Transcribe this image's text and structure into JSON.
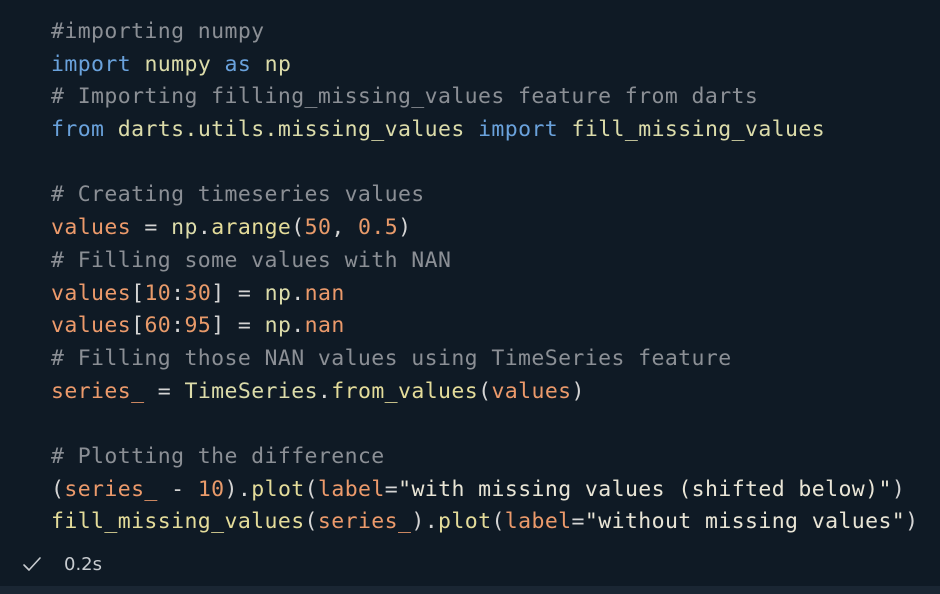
{
  "code_lines": [
    [
      {
        "t": "#importing numpy",
        "c": "comment"
      }
    ],
    [
      {
        "t": "import",
        "c": "keyword"
      },
      {
        "t": " ",
        "c": "plain"
      },
      {
        "t": "numpy",
        "c": "module"
      },
      {
        "t": " ",
        "c": "plain"
      },
      {
        "t": "as",
        "c": "keyword"
      },
      {
        "t": " ",
        "c": "plain"
      },
      {
        "t": "np",
        "c": "module"
      }
    ],
    [
      {
        "t": "# Importing filling_missing_values feature from darts",
        "c": "comment"
      }
    ],
    [
      {
        "t": "from",
        "c": "keyword"
      },
      {
        "t": " ",
        "c": "plain"
      },
      {
        "t": "darts.utils.missing_values",
        "c": "module"
      },
      {
        "t": " ",
        "c": "plain"
      },
      {
        "t": "import",
        "c": "keyword"
      },
      {
        "t": " ",
        "c": "plain"
      },
      {
        "t": "fill_missing_values",
        "c": "module"
      }
    ],
    [],
    [
      {
        "t": "# Creating timeseries values",
        "c": "comment"
      }
    ],
    [
      {
        "t": "values",
        "c": "var"
      },
      {
        "t": " = ",
        "c": "plain"
      },
      {
        "t": "np",
        "c": "module"
      },
      {
        "t": ".",
        "c": "plain"
      },
      {
        "t": "arange",
        "c": "func"
      },
      {
        "t": "(",
        "c": "paren"
      },
      {
        "t": "50",
        "c": "num"
      },
      {
        "t": ", ",
        "c": "plain"
      },
      {
        "t": "0.5",
        "c": "num"
      },
      {
        "t": ")",
        "c": "paren"
      }
    ],
    [
      {
        "t": "# Filling some values with NAN",
        "c": "comment"
      }
    ],
    [
      {
        "t": "values",
        "c": "var"
      },
      {
        "t": "[",
        "c": "plain"
      },
      {
        "t": "10",
        "c": "num"
      },
      {
        "t": ":",
        "c": "plain"
      },
      {
        "t": "30",
        "c": "num"
      },
      {
        "t": "] = ",
        "c": "plain"
      },
      {
        "t": "np",
        "c": "module"
      },
      {
        "t": ".",
        "c": "plain"
      },
      {
        "t": "nan",
        "c": "var"
      }
    ],
    [
      {
        "t": "values",
        "c": "var"
      },
      {
        "t": "[",
        "c": "plain"
      },
      {
        "t": "60",
        "c": "num"
      },
      {
        "t": ":",
        "c": "plain"
      },
      {
        "t": "95",
        "c": "num"
      },
      {
        "t": "] = ",
        "c": "plain"
      },
      {
        "t": "np",
        "c": "module"
      },
      {
        "t": ".",
        "c": "plain"
      },
      {
        "t": "nan",
        "c": "var"
      }
    ],
    [
      {
        "t": "# Filling those NAN values using TimeSeries feature",
        "c": "comment"
      }
    ],
    [
      {
        "t": "series_",
        "c": "var"
      },
      {
        "t": " = ",
        "c": "plain"
      },
      {
        "t": "TimeSeries",
        "c": "module"
      },
      {
        "t": ".",
        "c": "plain"
      },
      {
        "t": "from_values",
        "c": "func"
      },
      {
        "t": "(",
        "c": "paren"
      },
      {
        "t": "values",
        "c": "var"
      },
      {
        "t": ")",
        "c": "paren"
      }
    ],
    [],
    [
      {
        "t": "# Plotting the difference",
        "c": "comment"
      }
    ],
    [
      {
        "t": "(",
        "c": "paren"
      },
      {
        "t": "series_",
        "c": "var"
      },
      {
        "t": " - ",
        "c": "plain"
      },
      {
        "t": "10",
        "c": "num"
      },
      {
        "t": ")",
        "c": "paren"
      },
      {
        "t": ".",
        "c": "plain"
      },
      {
        "t": "plot",
        "c": "func"
      },
      {
        "t": "(",
        "c": "paren"
      },
      {
        "t": "label",
        "c": "var"
      },
      {
        "t": "=",
        "c": "plain"
      },
      {
        "t": "\"with missing values (shifted below)\"",
        "c": "str"
      },
      {
        "t": ")",
        "c": "paren"
      }
    ],
    [
      {
        "t": "fill_missing_values",
        "c": "func"
      },
      {
        "t": "(",
        "c": "paren"
      },
      {
        "t": "series_",
        "c": "var"
      },
      {
        "t": ")",
        "c": "paren"
      },
      {
        "t": ".",
        "c": "plain"
      },
      {
        "t": "plot",
        "c": "func"
      },
      {
        "t": "(",
        "c": "paren"
      },
      {
        "t": "label",
        "c": "var"
      },
      {
        "t": "=",
        "c": "plain"
      },
      {
        "t": "\"without missing values\"",
        "c": "str"
      },
      {
        "t": ")",
        "c": "paren"
      }
    ]
  ],
  "status": {
    "icon": "check-icon",
    "time": "0.2s",
    "color": "#c8ccd0"
  }
}
